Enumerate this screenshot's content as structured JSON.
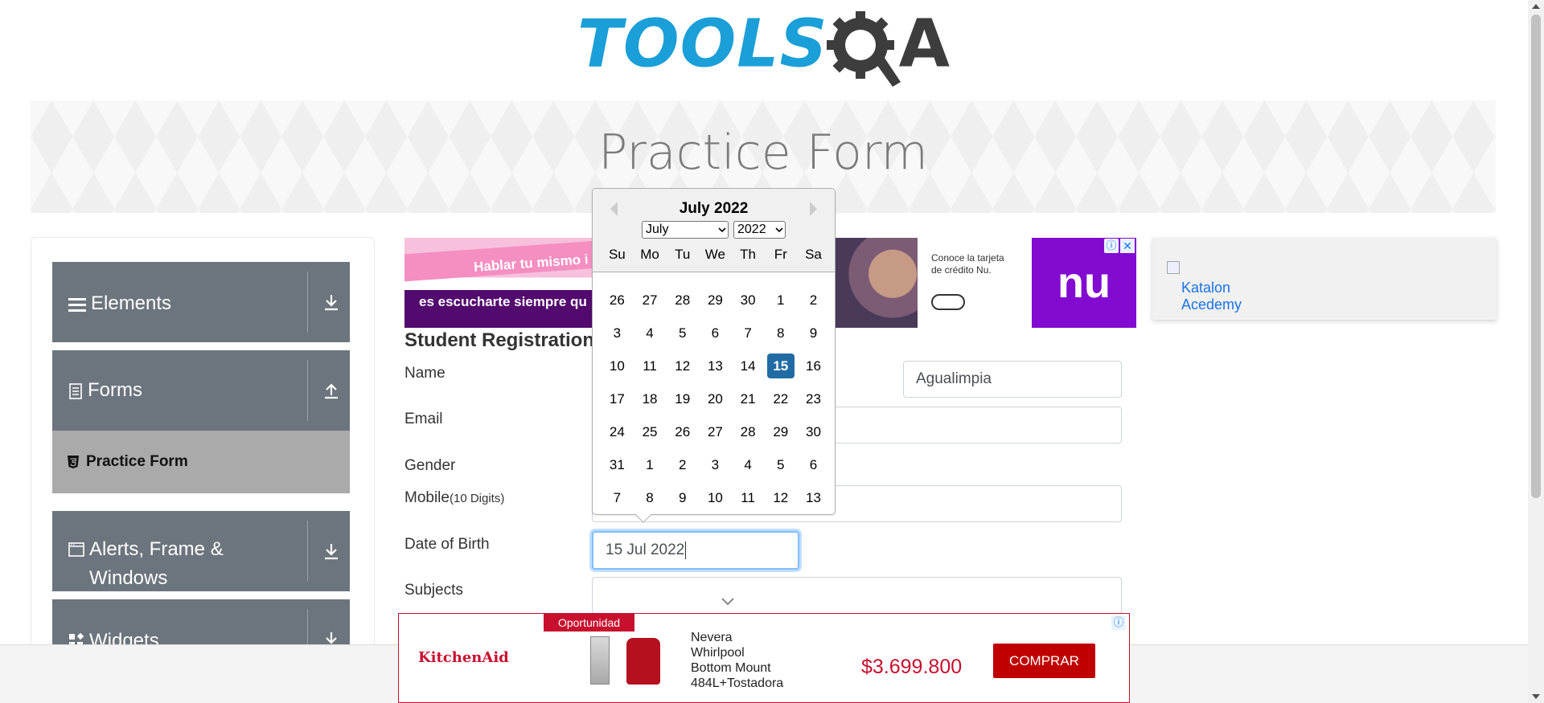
{
  "logo": {
    "tools": "TOOLS",
    "a": "A"
  },
  "page_title": "Practice Form",
  "sidebar": {
    "groups": [
      {
        "label": "Elements",
        "icon": "hamburger-icon",
        "arrow": "download-icon"
      },
      {
        "label": "Forms",
        "icon": "document-icon",
        "arrow": "upload-icon"
      },
      {
        "label": "Alerts, Frame &",
        "label2": "Windows",
        "icon": "window-icon",
        "arrow": "download-icon"
      },
      {
        "label": "Widgets",
        "icon": "widgets-icon",
        "arrow": "download-icon"
      }
    ],
    "active_item": {
      "label": "Practice Form",
      "icon": "html5-icon"
    }
  },
  "ads": {
    "top": {
      "line1": "Hablar tu mismo i",
      "line2": "es escucharte siempre qu",
      "nu_text1": "Conoce la tarjeta",
      "nu_text2": "de crédito Nu.",
      "nu_logo": "nu",
      "info": "ⓘ",
      "close": "✕"
    },
    "katalon": {
      "alt": "Katalon Acedemy"
    },
    "bottom": {
      "brand": "KitchenAid",
      "tag": "Oportunidad",
      "product_lines": [
        "Nevera",
        "Whirlpool",
        "Bottom Mount",
        "484L+Tostadora"
      ],
      "price": "$3.699.800",
      "cta": "COMPRAR",
      "info": "ⓘ"
    }
  },
  "form": {
    "title": "Student Registration",
    "labels": {
      "name": "Name",
      "email": "Email",
      "gender": "Gender",
      "mobile": "Mobile",
      "mobile_hint": "(10 Digits)",
      "dob": "Date of Birth",
      "subjects": "Subjects"
    },
    "last_name_value": "Agualimpia",
    "dob_value": "15 Jul 2022"
  },
  "datepicker": {
    "month_title": "July 2022",
    "month_select": "July",
    "year_select": "2022",
    "weekdays": [
      "Su",
      "Mo",
      "Tu",
      "We",
      "Th",
      "Fr",
      "Sa"
    ],
    "weeks": [
      [
        "26",
        "27",
        "28",
        "29",
        "30",
        "1",
        "2"
      ],
      [
        "3",
        "4",
        "5",
        "6",
        "7",
        "8",
        "9"
      ],
      [
        "10",
        "11",
        "12",
        "13",
        "14",
        "15",
        "16"
      ],
      [
        "17",
        "18",
        "19",
        "20",
        "21",
        "22",
        "23"
      ],
      [
        "24",
        "25",
        "26",
        "27",
        "28",
        "29",
        "30"
      ],
      [
        "31",
        "1",
        "2",
        "3",
        "4",
        "5",
        "6"
      ],
      [
        "7",
        "8",
        "9",
        "10",
        "11",
        "12",
        "13"
      ]
    ],
    "selected": "15"
  },
  "colors": {
    "brand_blue": "#1a9fd8",
    "sidebar_bg": "#6c757d",
    "selected_day": "#216ba5",
    "ad_red": "#c8102e",
    "nu_purple": "#820ad1"
  }
}
